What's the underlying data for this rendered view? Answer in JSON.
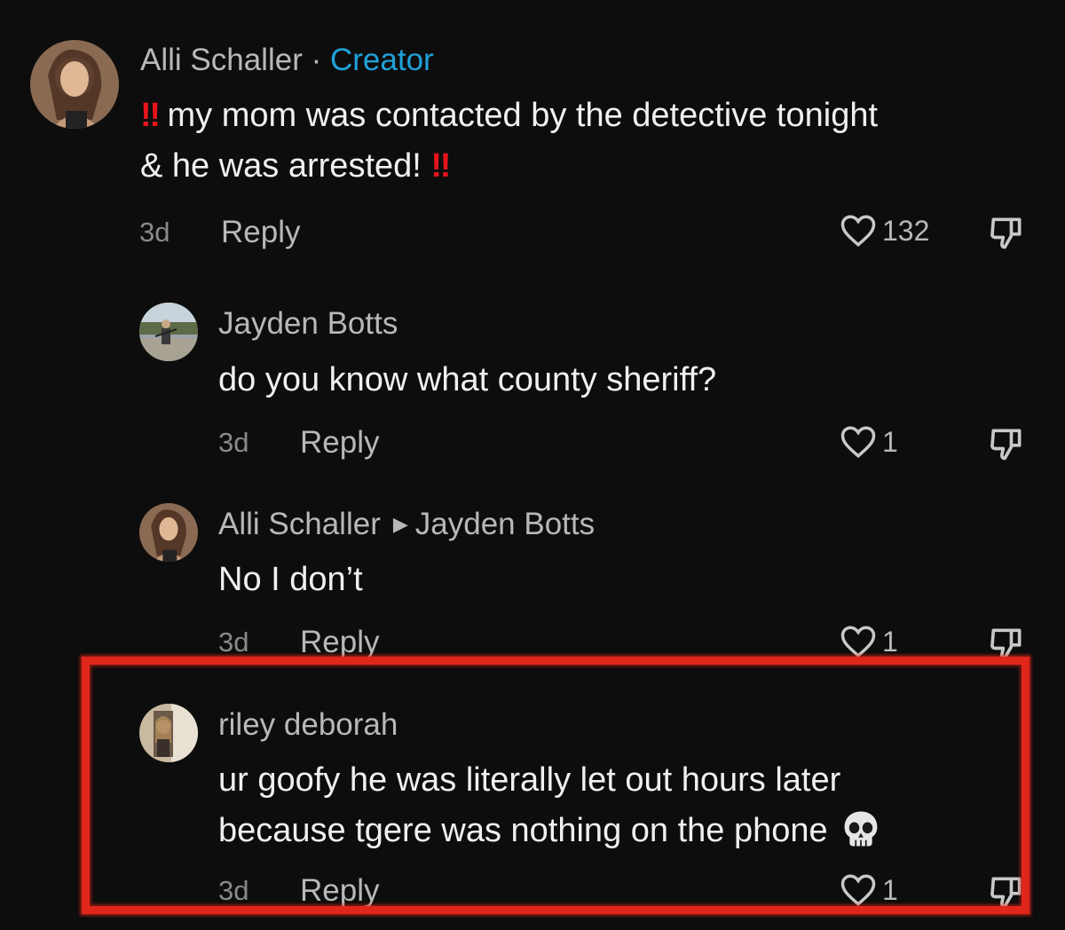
{
  "comments": [
    {
      "author": "Alli Schaller",
      "separator": "·",
      "creator_label": "Creator",
      "bang_start": "‼",
      "line1": " my mom was contacted by the detective tonight",
      "line2": "& he was arrested! ",
      "bang_end": "‼",
      "time": "3d",
      "reply_label": "Reply",
      "likes": "132"
    },
    {
      "author": "Jayden Botts",
      "text": "do you know what county sheriff?",
      "time": "3d",
      "reply_label": "Reply",
      "likes": "1"
    },
    {
      "author": "Alli Schaller",
      "reply_to": "Jayden Botts",
      "text": "No I don’t",
      "time": "3d",
      "reply_label": "Reply",
      "likes": "1"
    },
    {
      "author": "riley deborah",
      "line1": "ur goofy he was literally let out hours later",
      "line2": "because tgere was nothing on the phone",
      "time": "3d",
      "reply_label": "Reply",
      "likes": "1"
    }
  ],
  "colors": {
    "background": "#0d0d0d",
    "creator": "#1fa2d8",
    "highlight": "#e1261c",
    "bang": "#e8141c"
  },
  "icons": {
    "like": "heart-outline-icon",
    "dislike": "thumbs-down-icon",
    "emoji": "skull-emoji"
  }
}
